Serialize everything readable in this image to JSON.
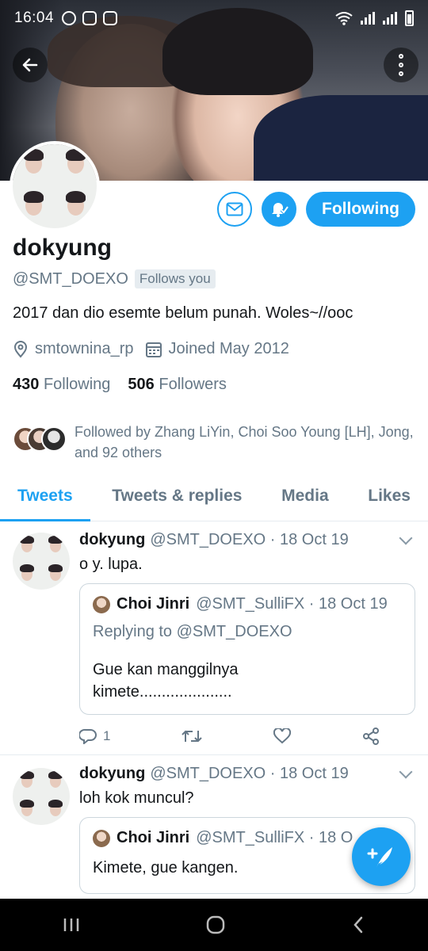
{
  "status_bar": {
    "time": "16:04"
  },
  "profile": {
    "name": "dokyung",
    "handle": "@SMT_DOEXO",
    "follows_you_label": "Follows you",
    "bio": "2017 dan dio esemte belum punah. Woles~//ooc",
    "location": "smtownina_rp",
    "joined": "Joined May 2012",
    "following_count": "430",
    "following_label": "Following",
    "followers_count": "506",
    "followers_label": "Followers",
    "followed_by": "Followed by Zhang LiYin, Choi Soo Young [LH], Jong, and 92 others",
    "follow_button_label": "Following"
  },
  "tabs": [
    {
      "label": "Tweets",
      "active": true
    },
    {
      "label": "Tweets & replies",
      "active": false
    },
    {
      "label": "Media",
      "active": false
    },
    {
      "label": "Likes",
      "active": false
    }
  ],
  "tweets": [
    {
      "name": "dokyung",
      "handle_date": "@SMT_DOEXO · 18 Oct 19",
      "text": "o y. lupa.",
      "quote": {
        "name": "Choi Jinri",
        "handle_date": "@SMT_SulliFX · 18 Oct 19",
        "replying_to": "Replying to @SMT_DOEXO",
        "text_line1": "Gue kan manggilnya",
        "text_line2": "kimete....................."
      },
      "reply_count": "1"
    },
    {
      "name": "dokyung",
      "handle_date": "@SMT_DOEXO · 18 Oct 19",
      "text": "loh kok muncul?",
      "quote": {
        "name": "Choi Jinri",
        "handle_date": "@SMT_SulliFX · 18 O",
        "text": "Kimete, gue kangen."
      }
    }
  ],
  "colors": {
    "accent": "#1da1f2",
    "muted": "#657786",
    "text": "#14171a"
  },
  "icons": [
    "back-arrow-icon",
    "more-vertical-icon",
    "mail-icon",
    "bell-icon",
    "location-icon",
    "calendar-icon",
    "reply-icon",
    "retweet-icon",
    "like-icon",
    "share-icon",
    "compose-icon"
  ]
}
